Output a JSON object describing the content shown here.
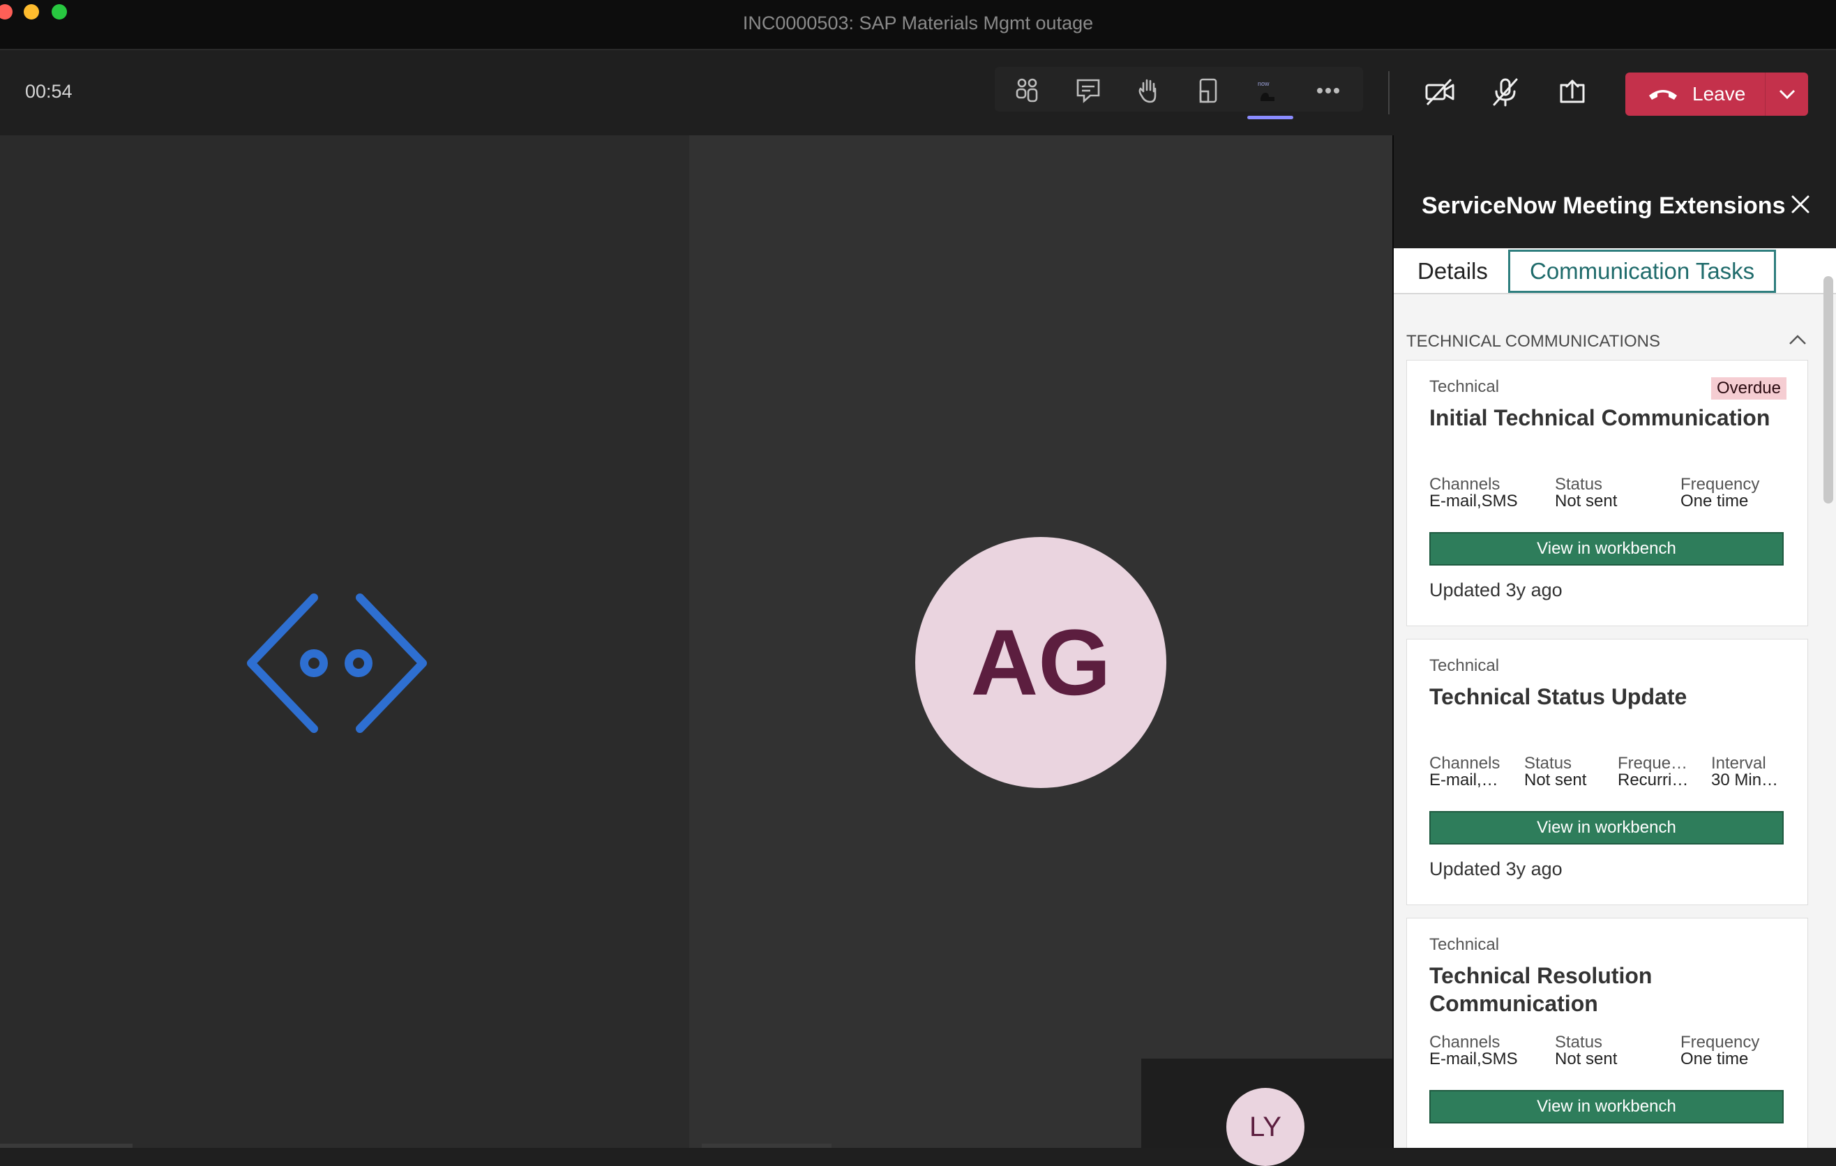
{
  "window": {
    "title": "INC0000503: SAP Materials Mgmt outage"
  },
  "toolbar": {
    "timer": "00:54",
    "leave_label": "Leave"
  },
  "stage": {
    "participant_initials": "AG",
    "self_initials": "LY"
  },
  "panel": {
    "title": "ServiceNow Meeting Extensions",
    "tabs": {
      "details": "Details",
      "communication_tasks": "Communication Tasks"
    },
    "section_title": "TECHNICAL COMMUNICATIONS",
    "cards": [
      {
        "type": "Technical",
        "badge": "Overdue",
        "title": "Initial Technical Communication",
        "fields": [
          {
            "label": "Channels",
            "value": "E-mail,SMS"
          },
          {
            "label": "Status",
            "value": "Not sent"
          },
          {
            "label": "Frequency",
            "value": "One time"
          }
        ],
        "button": "View in workbench",
        "updated": "Updated 3y ago"
      },
      {
        "type": "Technical",
        "title": "Technical Status Update",
        "fields": [
          {
            "label": "Channels",
            "value": "E-mail,…"
          },
          {
            "label": "Status",
            "value": "Not sent"
          },
          {
            "label": "Freque…",
            "value": "Recurri…"
          },
          {
            "label": "Interval",
            "value": "30 Min…"
          }
        ],
        "button": "View in workbench",
        "updated": "Updated 3y ago"
      },
      {
        "type": "Technical",
        "title": "Technical Resolution Communication",
        "fields": [
          {
            "label": "Channels",
            "value": "E-mail,SMS"
          },
          {
            "label": "Status",
            "value": "Not sent"
          },
          {
            "label": "Frequency",
            "value": "One time"
          }
        ],
        "button": "View in workbench"
      }
    ]
  },
  "colors": {
    "leave": "#c4314b",
    "accent_teal": "#2e7e7e",
    "workbench_button": "#2e7d5b",
    "overdue_badge": "#f5cdd2",
    "bot_logo": "#2e6fd1"
  },
  "icons": [
    "participants-icon",
    "chat-icon",
    "raise-hand-icon",
    "rooms-icon",
    "servicenow-app-icon",
    "more-icon",
    "camera-off-icon",
    "mic-off-icon",
    "share-screen-icon",
    "phone-hangup-icon",
    "chevron-down-icon",
    "close-icon",
    "chevron-up-icon",
    "bot-logo-icon"
  ]
}
